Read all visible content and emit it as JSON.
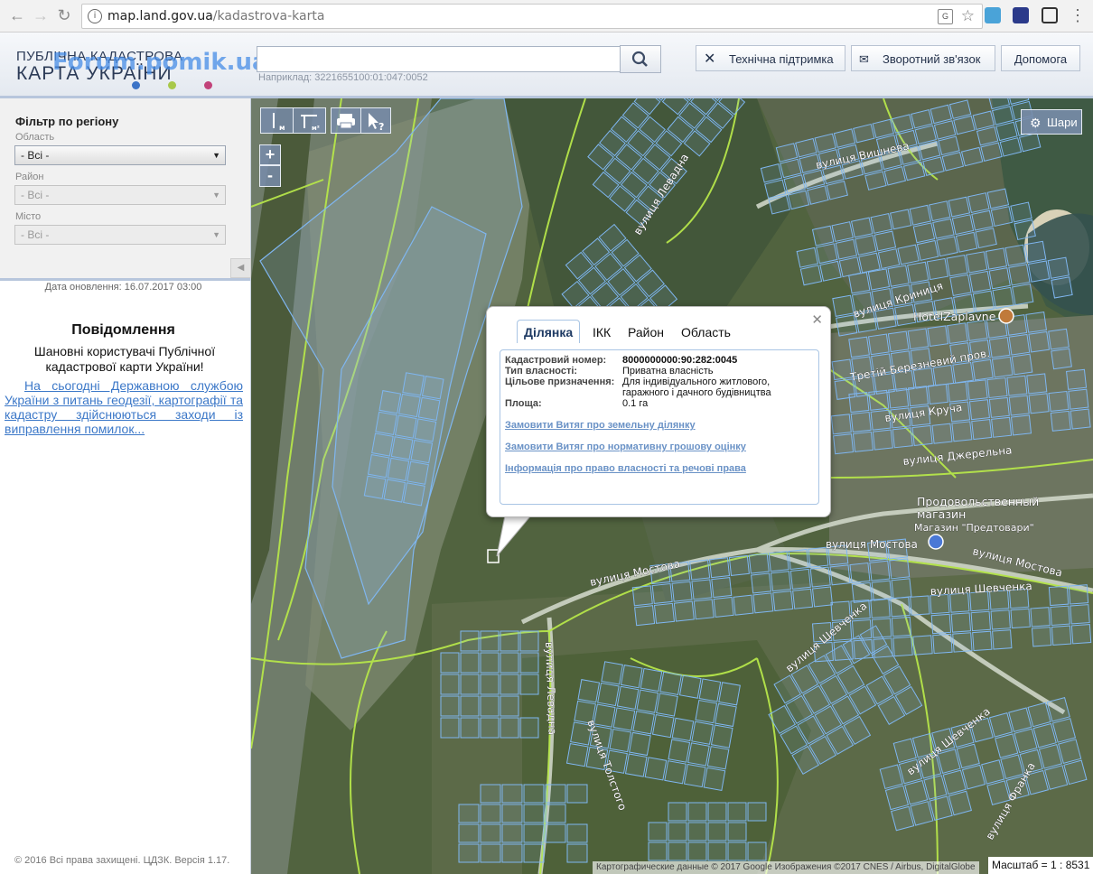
{
  "browser": {
    "url_host": "map.land.gov.ua",
    "url_path": "/kadastrova-karta"
  },
  "header": {
    "logo_line1": "ПУБЛІЧНА КАДАСТРОВА",
    "logo_line2": "КАРТА УКРАЇНИ",
    "watermark": "Forum.pomik.ua",
    "search_placeholder": "",
    "search_hint": "Наприклад: 3221655100:01:047:0052",
    "buttons": {
      "support": "Технічна підтримка",
      "feedback": "Зворотний зв'язок",
      "help": "Допомога"
    }
  },
  "sidebar": {
    "filter_title": "Фільтр по регіону",
    "oblast_label": "Область",
    "oblast_value": "- Всі -",
    "rayon_label": "Район",
    "rayon_value": "- Всі -",
    "city_label": "Місто",
    "city_value": "- Всі -",
    "update_date": "Дата оновлення: 16.07.2017 03:00",
    "message_title": "Повідомлення",
    "message_body": "Шановні користувачі Публічної кадастрової карти України!",
    "message_link": "На сьогодні Державною службою України з питань геодезії, картографії та кадастру здійснюються заходи із виправлення помилок...",
    "copyright": "© 2016 Всі права захищені. ЦДЗК. Версія 1.17."
  },
  "map": {
    "layers_button": "Шари",
    "zoom_in": "+",
    "zoom_out": "-",
    "attribution": "Картографические данные © 2017 Google Изображения ©2017 CNES / Airbus, DigitalGlobe",
    "scale": "Масштаб = 1 : 8531",
    "streets": {
      "vyshneva": "вулиця Вишнева",
      "kryntsya": "вулиця Криниця",
      "tretii": "Третій Березневий пров.",
      "krucha": "вулиця Круча",
      "dzherelna": "вулиця Джерельна",
      "mostova_w": "вулиця Мостова",
      "mostova_c": "вулиця Мостова",
      "mostova_e": "вулиця Мостова",
      "shevchenka_e": "вулиця Шевченка",
      "shevchenka_d": "вулиця Шевченка",
      "shevchenka_s": "вулиця Шевченка",
      "levadna": "вулиця Левадна",
      "levadna_n": "вулиця Левадна",
      "tolstogo": "вулиця Толстого",
      "franka": "вулиця Франка"
    },
    "pois": {
      "hotel": "HotelZaplavne",
      "shop1": "Продовольственный",
      "shop2": "магазин",
      "shop3": "Магазин \"Предтовари\""
    }
  },
  "popup": {
    "tabs": [
      "Ділянка",
      "ІКК",
      "Район",
      "Область"
    ],
    "labels": {
      "cad_num": "Кадастровий номер:",
      "ownership": "Тип власності:",
      "purpose": "Цільове призначення:",
      "area": "Площа:"
    },
    "values": {
      "cad_num": "8000000000:90:282:0045",
      "ownership": "Приватна власність",
      "purpose": "Для індивідуального житлового, гаражного і дачного будівництва",
      "area": "0.1 га"
    },
    "links": {
      "extract_land": "Замовити Витяг про земельну ділянку",
      "extract_valuation": "Замовити Витяг про нормативну грошову оцінку",
      "ownership_info": "Інформація про право власності та речові права"
    }
  },
  "colors": {
    "parcel_stroke": "#7fb6f0",
    "boundary": "#b6e64a",
    "road": "#cfd6c8",
    "link": "#3c78c8"
  }
}
